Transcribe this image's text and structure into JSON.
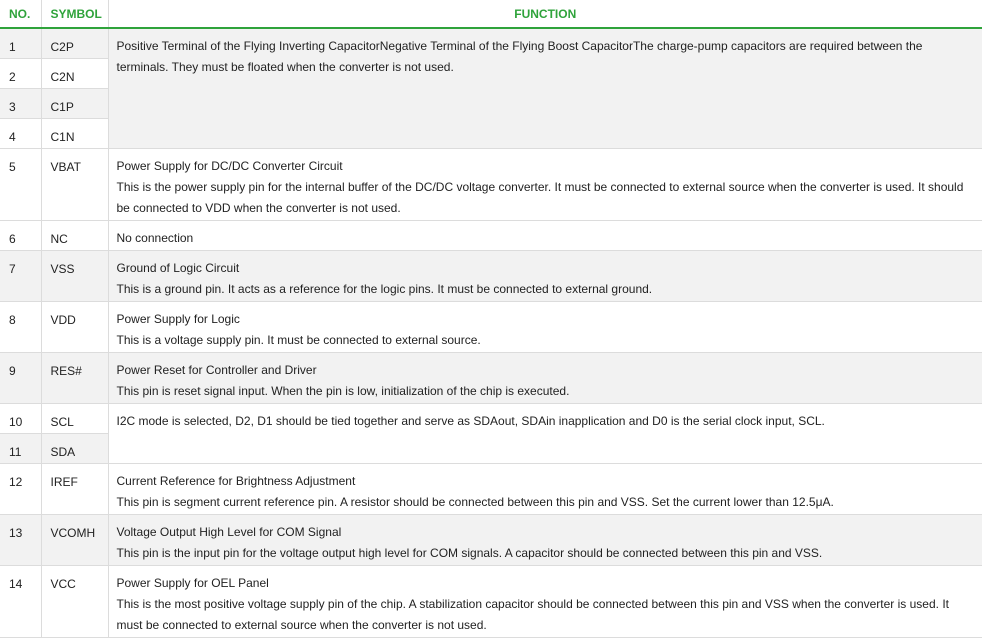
{
  "header": {
    "no": "NO.",
    "symbol": "SYMBOL",
    "function": "FUNCTION"
  },
  "pins": [
    {
      "no": "1",
      "symbol": "C2P"
    },
    {
      "no": "2",
      "symbol": "C2N"
    },
    {
      "no": "3",
      "symbol": "C1P"
    },
    {
      "no": "4",
      "symbol": "C1N"
    },
    {
      "no": "5",
      "symbol": "VBAT"
    },
    {
      "no": "6",
      "symbol": "NC"
    },
    {
      "no": "7",
      "symbol": "VSS"
    },
    {
      "no": "8",
      "symbol": "VDD"
    },
    {
      "no": "9",
      "symbol": "RES#"
    },
    {
      "no": "10",
      "symbol": "SCL"
    },
    {
      "no": "11",
      "symbol": "SDA"
    },
    {
      "no": "12",
      "symbol": "IREF"
    },
    {
      "no": "13",
      "symbol": "VCOMH"
    },
    {
      "no": "14",
      "symbol": "VCC"
    }
  ],
  "functions": [
    {
      "title": "Positive Terminal of the Flying Inverting CapacitorNegative Terminal of the Flying Boost CapacitorThe charge-pump capacitors are required between the terminals. They must be floated when the converter is not used.",
      "desc": ""
    },
    {
      "title": "Power Supply for DC/DC Converter Circuit",
      "desc": "This is the power supply pin for the internal buffer of the DC/DC voltage converter. It must be connected to external source when the converter is used. It should be connected to VDD when the converter is not used."
    },
    {
      "title": "No connection",
      "desc": ""
    },
    {
      "title": "Ground of Logic Circuit",
      "desc": "This is a ground pin. It acts as a reference for the logic pins. It must be connected to external ground."
    },
    {
      "title": "Power Supply for Logic",
      "desc": "This is a voltage supply pin. It must be connected to external source."
    },
    {
      "title": "Power Reset for Controller and Driver",
      "desc": "This pin is reset signal input. When the pin is low, initialization of the chip is executed."
    },
    {
      "title": "I2C mode is selected, D2, D1 should be tied together and serve as SDAout, SDAin inapplication and D0 is the serial clock input, SCL.",
      "desc": ""
    },
    {
      "title": "Current Reference for Brightness Adjustment",
      "desc": "This pin is segment current reference pin. A resistor should be connected between this pin and VSS. Set the current lower than 12.5μA."
    },
    {
      "title": "Voltage Output High Level for COM Signal",
      "desc": "This pin is the input pin for the voltage output high level for COM signals. A capacitor should be connected between this pin and VSS."
    },
    {
      "title": "Power Supply for OEL Panel",
      "desc": "This is the most positive voltage supply pin of the chip. A stabilization capacitor should be connected between this pin and VSS when the converter is used. It must be connected to external source when the converter is not used."
    }
  ]
}
